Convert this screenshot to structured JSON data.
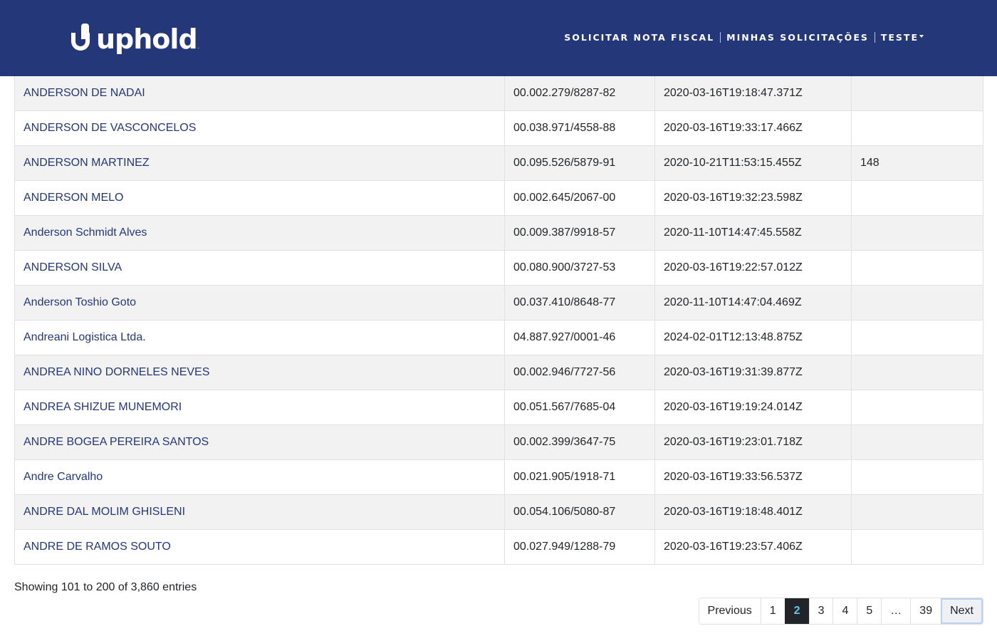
{
  "header": {
    "logo_text": "uphold",
    "logo_mark": ".",
    "nav": {
      "solicitar": "SOLICITAR NOTA FISCAL",
      "minhas": "MINHAS SOLICITAÇÕES",
      "teste": "TESTE"
    }
  },
  "table": {
    "rows": [
      {
        "name": "ANDERSON DE NADAI",
        "doc": "00.002.279/8287-82",
        "date": "2020-03-16T19:18:47.371Z",
        "extra": ""
      },
      {
        "name": "ANDERSON DE VASCONCELOS",
        "doc": "00.038.971/4558-88",
        "date": "2020-03-16T19:33:17.466Z",
        "extra": ""
      },
      {
        "name": "ANDERSON MARTINEZ",
        "doc": "00.095.526/5879-91",
        "date": "2020-10-21T11:53:15.455Z",
        "extra": "148"
      },
      {
        "name": "ANDERSON MELO",
        "doc": "00.002.645/2067-00",
        "date": "2020-03-16T19:32:23.598Z",
        "extra": ""
      },
      {
        "name": "Anderson Schmidt Alves",
        "doc": "00.009.387/9918-57",
        "date": "2020-11-10T14:47:45.558Z",
        "extra": ""
      },
      {
        "name": "ANDERSON SILVA",
        "doc": "00.080.900/3727-53",
        "date": "2020-03-16T19:22:57.012Z",
        "extra": ""
      },
      {
        "name": "Anderson Toshio Goto",
        "doc": "00.037.410/8648-77",
        "date": "2020-11-10T14:47:04.469Z",
        "extra": ""
      },
      {
        "name": "Andreani Logistica Ltda.",
        "doc": "04.887.927/0001-46",
        "date": "2024-02-01T12:13:48.875Z",
        "extra": ""
      },
      {
        "name": "ANDREA NINO DORNELES NEVES",
        "doc": "00.002.946/7727-56",
        "date": "2020-03-16T19:31:39.877Z",
        "extra": ""
      },
      {
        "name": "ANDREA SHIZUE MUNEMORI",
        "doc": "00.051.567/7685-04",
        "date": "2020-03-16T19:19:24.014Z",
        "extra": ""
      },
      {
        "name": "ANDRE BOGEA PEREIRA SANTOS",
        "doc": "00.002.399/3647-75",
        "date": "2020-03-16T19:23:01.718Z",
        "extra": ""
      },
      {
        "name": "Andre Carvalho",
        "doc": "00.021.905/1918-71",
        "date": "2020-03-16T19:33:56.537Z",
        "extra": ""
      },
      {
        "name": "ANDRE DAL MOLIM GHISLENI",
        "doc": "00.054.106/5080-87",
        "date": "2020-03-16T19:18:48.401Z",
        "extra": ""
      },
      {
        "name": "ANDRE DE RAMOS SOUTO",
        "doc": "00.027.949/1288-79",
        "date": "2020-03-16T19:23:57.406Z",
        "extra": ""
      }
    ]
  },
  "info": "Showing 101 to 200 of 3,860 entries",
  "pagination": {
    "previous": "Previous",
    "pages": [
      "1",
      "2",
      "3",
      "4",
      "5"
    ],
    "active": "2",
    "ellipsis": "…",
    "last": "39",
    "next": "Next"
  },
  "colors": {
    "navbar": "#243779",
    "link": "#243779",
    "active_page_bg": "#212529",
    "active_page_text": "#5ec8f0"
  }
}
